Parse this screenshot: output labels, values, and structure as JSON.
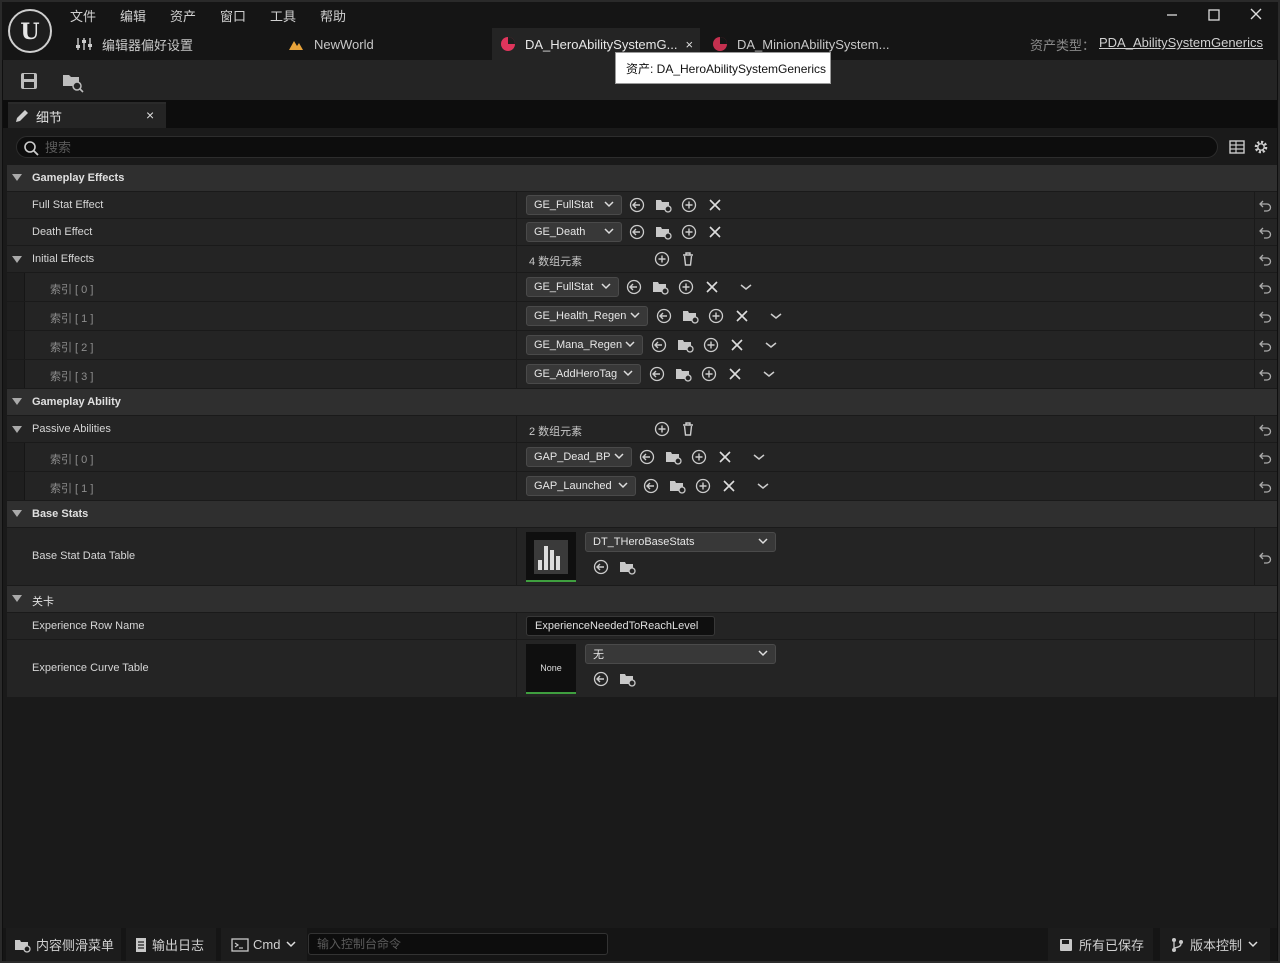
{
  "menu": [
    "文件",
    "编辑",
    "资产",
    "窗口",
    "工具",
    "帮助"
  ],
  "tabs": [
    {
      "label": "编辑器偏好设置",
      "icon": "sliders-icon"
    },
    {
      "label": "NewWorld",
      "icon": "level-icon"
    },
    {
      "label": "DA_HeroAbilitySystemG...",
      "icon": "data-asset-icon",
      "active": true,
      "close": "×"
    },
    {
      "label": "DA_MinionAbilitySystem...",
      "icon": "data-asset-icon"
    }
  ],
  "tooltip": "资产: DA_HeroAbilitySystemGenerics",
  "asset_type": {
    "label": "资产类型：",
    "value": "PDA_AbilitySystemGenerics"
  },
  "details_tab": {
    "label": "细节",
    "close": "×"
  },
  "search": {
    "placeholder": "搜索"
  },
  "categories": {
    "gameplay_effects": "Gameplay Effects",
    "gameplay_ability": "Gameplay Ability",
    "base_stats": "Base Stats",
    "level": "关卡"
  },
  "props": {
    "full_stat_effect": {
      "name": "Full Stat Effect",
      "value": "GE_FullStat"
    },
    "death_effect": {
      "name": "Death Effect",
      "value": "GE_Death"
    },
    "initial_effects": {
      "name": "Initial Effects",
      "count": "4 数组元素",
      "items": [
        {
          "index": "索引 [ 0 ]",
          "value": "GE_FullStat"
        },
        {
          "index": "索引 [ 1 ]",
          "value": "GE_Health_Regen"
        },
        {
          "index": "索引 [ 2 ]",
          "value": "GE_Mana_Regen"
        },
        {
          "index": "索引 [ 3 ]",
          "value": "GE_AddHeroTag"
        }
      ]
    },
    "passive_abilities": {
      "name": "Passive Abilities",
      "count": "2 数组元素",
      "items": [
        {
          "index": "索引 [ 0 ]",
          "value": "GAP_Dead_BP"
        },
        {
          "index": "索引 [ 1 ]",
          "value": "GAP_Launched"
        }
      ]
    },
    "base_stat_data_table": {
      "name": "Base Stat Data Table",
      "value": "DT_THeroBaseStats"
    },
    "experience_row_name": {
      "name": "Experience Row Name",
      "value": "ExperienceNeededToReachLevel"
    },
    "experience_curve_table": {
      "name": "Experience Curve Table",
      "value": "无",
      "thumb": "None"
    }
  },
  "status_bar": {
    "content_drawer": "内容侧滑菜单",
    "output_log": "输出日志",
    "cmd": "Cmd",
    "console_placeholder": "输入控制台命令",
    "all_saved": "所有已保存",
    "source_control": "版本控制"
  },
  "colors": {
    "accent_green": "#3f9f3f",
    "asset_icon": "#e0355c",
    "level_icon": "#e8a33a"
  }
}
